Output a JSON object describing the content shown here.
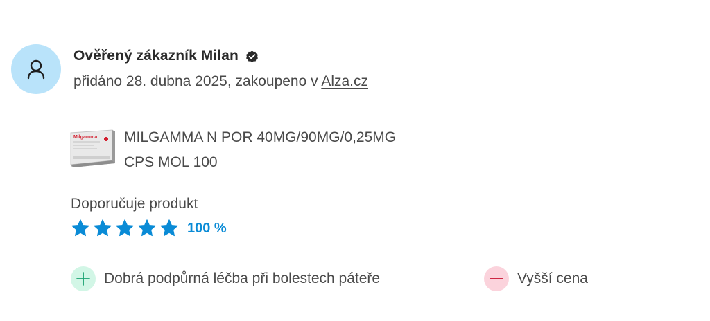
{
  "reviewer": {
    "name": "Ověřený zákazník Milan",
    "added_prefix": "přidáno 28. dubna 2025, zakoupeno v ",
    "store": "Alza.cz"
  },
  "product": {
    "name_line1": "MILGAMMA N POR 40MG/90MG/0,25MG",
    "name_line2": "CPS MOL 100",
    "image_brand": "Milgamma"
  },
  "recommendation": {
    "label": "Doporučuje produkt",
    "stars": 5,
    "percent": "100 %"
  },
  "pros": [
    "Dobrá podpůrná léčba při bolestech páteře"
  ],
  "cons": [
    "Vyšší cena"
  ],
  "colors": {
    "avatar_bg": "#b9e3fa",
    "accent_blue": "#0a8bd6",
    "plus_bg": "#d2f6e6",
    "plus_icon": "#1aa271",
    "minus_bg": "#fbd3dc",
    "minus_icon": "#c8102e"
  },
  "icons": {
    "avatar": "user-icon",
    "verified": "verified-check-icon",
    "star": "star-icon",
    "pro": "plus-icon",
    "con": "minus-icon"
  }
}
